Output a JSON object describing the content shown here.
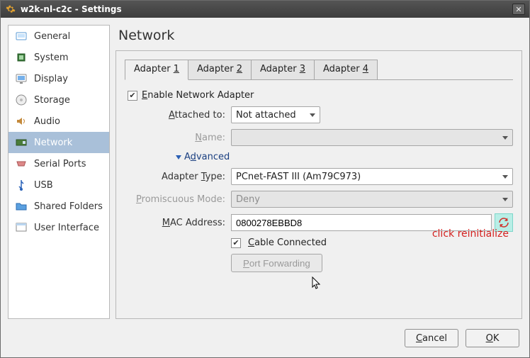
{
  "window_title": "w2k-nl-c2c - Settings",
  "sidebar": {
    "items": [
      {
        "label": "General"
      },
      {
        "label": "System"
      },
      {
        "label": "Display"
      },
      {
        "label": "Storage"
      },
      {
        "label": "Audio"
      },
      {
        "label": "Network",
        "selected": true
      },
      {
        "label": "Serial Ports"
      },
      {
        "label": "USB"
      },
      {
        "label": "Shared Folders"
      },
      {
        "label": "User Interface"
      }
    ]
  },
  "page_title": "Network",
  "tabs": [
    "Adapter 1",
    "Adapter 2",
    "Adapter 3",
    "Adapter 4"
  ],
  "active_tab": 0,
  "enable_adapter": {
    "label": "Enable Network Adapter",
    "checked": true
  },
  "attached_to": {
    "label": "Attached to:",
    "value": "Not attached"
  },
  "name": {
    "label": "Name:",
    "value": ""
  },
  "advanced_label": "Advanced",
  "adapter_type": {
    "label": "Adapter Type:",
    "value": "PCnet-FAST III (Am79C973)"
  },
  "promiscuous": {
    "label": "Promiscuous Mode:",
    "value": "Deny"
  },
  "mac": {
    "label": "MAC Address:",
    "value": "0800278EBBD8"
  },
  "cable": {
    "label": "Cable Connected",
    "checked": true
  },
  "port_forward": "Port Forwarding",
  "annotation": "click reinitialize",
  "buttons": {
    "cancel": "Cancel",
    "ok": "OK"
  }
}
